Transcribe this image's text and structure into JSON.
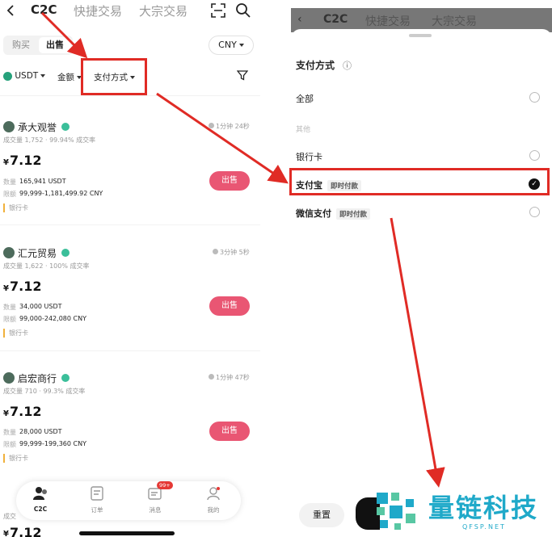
{
  "left": {
    "header": {
      "title": "C2C",
      "tabs": [
        "快捷交易",
        "大宗交易"
      ]
    },
    "segment": {
      "buy": "购买",
      "sell": "出售"
    },
    "currency": "CNY",
    "filters": {
      "coin": "USDT",
      "amount": "金额",
      "payment": "支付方式"
    },
    "listings": [
      {
        "name": "承大观誉",
        "stats": "成交量 1,752 · 99.94% 成交率",
        "time": "1分钟 24秒",
        "price_symbol": "¥",
        "price": "7.12",
        "qty_label": "数量",
        "qty": "165,941 USDT",
        "limit_label": "限额",
        "limit": "99,999-1,181,499.92 CNY",
        "pay": "银行卡",
        "action": "出售"
      },
      {
        "name": "汇元贸易",
        "stats": "成交量 1,622 · 100% 成交率",
        "time": "3分钟 5秒",
        "price_symbol": "¥",
        "price": "7.12",
        "qty_label": "数量",
        "qty": "34,000 USDT",
        "limit_label": "限额",
        "limit": "99,000-242,080 CNY",
        "pay": "银行卡",
        "action": "出售"
      },
      {
        "name": "启宏商行",
        "stats": "成交量 710 · 99.3% 成交率",
        "time": "1分钟 47秒",
        "price_symbol": "¥",
        "price": "7.12",
        "qty_label": "数量",
        "qty": "28,000 USDT",
        "limit_label": "限额",
        "limit": "99,999-199,360 CNY",
        "pay": "银行卡",
        "action": "出售"
      }
    ],
    "partial": {
      "stats": "成交",
      "price_symbol": "¥",
      "price": "7.12"
    },
    "nav": {
      "items": [
        "C2C",
        "订单",
        "消息",
        "我的"
      ],
      "badge": "99+"
    }
  },
  "right": {
    "header_ghost": {
      "title": "C2C",
      "tabs": [
        "快捷交易",
        "大宗交易"
      ]
    },
    "sheet_title": "支付方式",
    "info_icon": "ⓘ",
    "options": [
      {
        "label": "全部",
        "selected": false
      },
      {
        "label": "其他",
        "group": true
      },
      {
        "label": "银行卡",
        "selected": false
      },
      {
        "label": "支付宝",
        "tag": "即时付款",
        "selected": true
      },
      {
        "label": "微信支付",
        "tag": "即时付款",
        "selected": false
      }
    ],
    "reset": "重置"
  },
  "watermark": {
    "text": "量链科技",
    "sub": "QFSP.NET"
  },
  "colors": {
    "accent": "#e95673",
    "annotation": "#e02b25",
    "brand_watermark": "#1fa9c9"
  }
}
